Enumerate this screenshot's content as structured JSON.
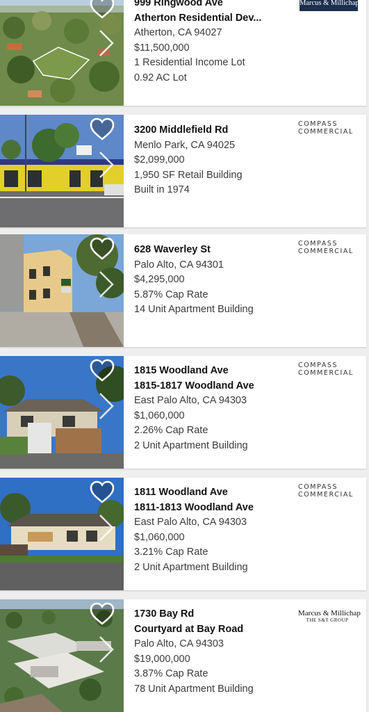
{
  "listings": [
    {
      "line1": "999 Ringwood Ave",
      "line2": "Atherton Residential Dev...",
      "location": "Atherton, CA 94027",
      "price": "$11,500,000",
      "detail1": "1 Residential Income Lot",
      "detail2": "0.92 AC Lot",
      "broker": {
        "style": "mm-box",
        "text1": "Marcus & Millichap"
      },
      "photo": "aerial-trees-lot"
    },
    {
      "line1": "3200 Middlefield Rd",
      "location": "Menlo Park, CA 94025",
      "price": "$2,099,000",
      "detail1": "1,950 SF Retail Building",
      "detail2": "Built in 1974",
      "broker": {
        "style": "compass",
        "text1": "COMPASS",
        "text2": "COMMERCIAL"
      },
      "photo": "yellow-retail-building"
    },
    {
      "line1": "628 Waverley St",
      "location": "Palo Alto, CA 94301",
      "price": "$4,295,000",
      "detail1": "5.87% Cap Rate",
      "detail2": "14 Unit Apartment Building",
      "broker": {
        "style": "compass",
        "text1": "COMPASS",
        "text2": "COMMERCIAL"
      },
      "photo": "tan-apartment-building"
    },
    {
      "line1": "1815 Woodland Ave",
      "line2": "1815-1817 Woodland Ave",
      "location": "East Palo Alto, CA 94303",
      "price": "$1,060,000",
      "detail1": "2.26% Cap Rate",
      "detail2": "2 Unit Apartment Building",
      "broker": {
        "style": "compass",
        "text1": "COMPASS",
        "text2": "COMMERCIAL"
      },
      "photo": "house-with-fence"
    },
    {
      "line1": "1811 Woodland Ave",
      "line2": "1811-1813 Woodland Ave",
      "location": "East Palo Alto, CA 94303",
      "price": "$1,060,000",
      "detail1": "3.21% Cap Rate",
      "detail2": "2 Unit Apartment Building",
      "broker": {
        "style": "compass",
        "text1": "COMPASS",
        "text2": "COMMERCIAL"
      },
      "photo": "single-story-house"
    },
    {
      "line1": "1730 Bay Rd",
      "line2": "Courtyard at Bay Road",
      "location": "Palo Alto, CA 94303",
      "price": "$19,000,000",
      "detail1": "3.87% Cap Rate",
      "detail2": "78 Unit Apartment Building",
      "broker": {
        "style": "mm-plain",
        "text1": "Marcus & Millichap",
        "text2": "THE S&T GROUP"
      },
      "photo": "aerial-apartment-complex"
    }
  ],
  "icons": {
    "favorite": "heart-outline-icon",
    "next": "chevron-right-icon"
  }
}
